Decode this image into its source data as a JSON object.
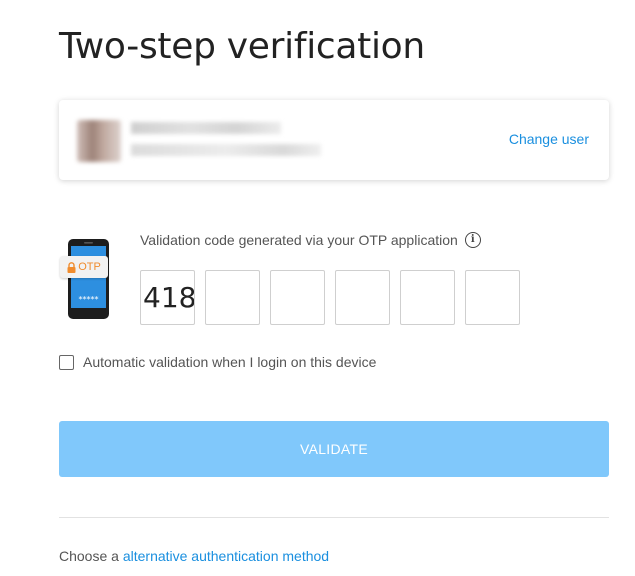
{
  "page": {
    "title": "Two-step verification"
  },
  "user": {
    "change_user_label": "Change user"
  },
  "otp": {
    "badge_label": "OTP",
    "screen_mask": "*****",
    "label": "Validation code generated via your OTP application",
    "info_icon": "info-icon",
    "digits": [
      "418",
      "",
      "",
      "",
      "",
      ""
    ]
  },
  "auto_validation": {
    "label": "Automatic validation when I login on this device",
    "checked": false
  },
  "actions": {
    "validate_label": "VALIDATE"
  },
  "footer": {
    "prefix": "Choose a",
    "link_label": "alternative authentication method"
  },
  "colors": {
    "link": "#1a8fdf",
    "validate_button_disabled": "#80c8fb",
    "otp_badge": "#f08c2e",
    "phone_screen": "#2d8fe0"
  }
}
